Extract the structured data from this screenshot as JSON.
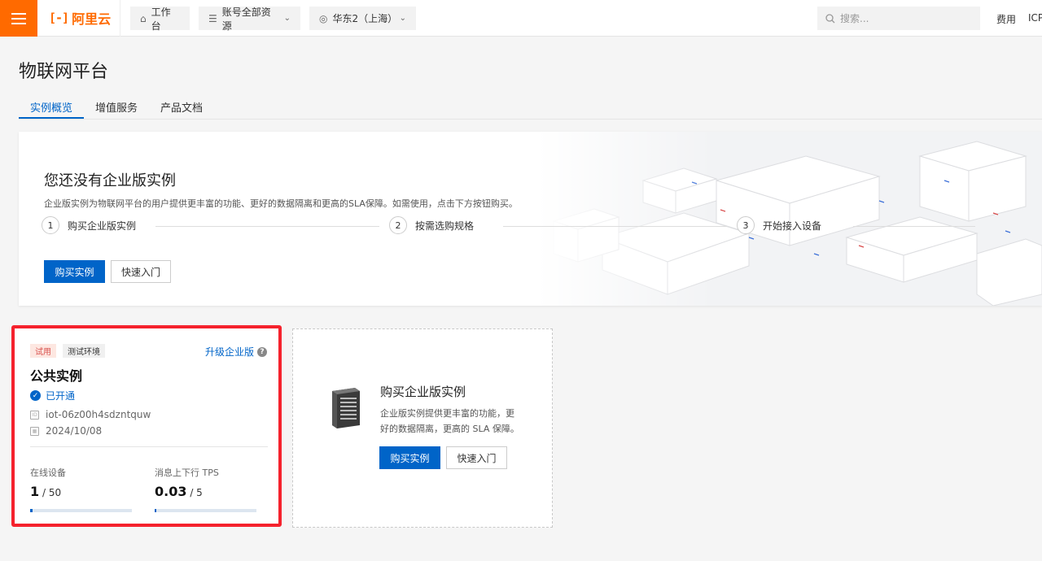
{
  "topbar": {
    "logo_mark": "[-]",
    "logo_text": "阿里云",
    "workbench": "工作台",
    "resources": "账号全部资源",
    "region": "华东2（上海）",
    "search_placeholder": "搜索...",
    "fee": "费用",
    "icp": "ICP"
  },
  "page": {
    "title": "物联网平台",
    "tabs": [
      "实例概览",
      "增值服务",
      "产品文档"
    ]
  },
  "hero": {
    "title": "您还没有企业版实例",
    "description": "企业版实例为物联网平台的用户提供更丰富的功能、更好的数据隔离和更高的SLA保障。如需使用，点击下方按钮购买。",
    "steps": [
      {
        "num": "1",
        "label": "购买企业版实例"
      },
      {
        "num": "2",
        "label": "按需选购规格"
      },
      {
        "num": "3",
        "label": "开始接入设备"
      }
    ],
    "buy_label": "购买实例",
    "start_label": "快速入门"
  },
  "instance": {
    "tag_trial": "试用",
    "tag_env": "测试环境",
    "upgrade": "升级企业版",
    "help": "?",
    "name": "公共实例",
    "status": "已开通",
    "id": "iot-06z00h4sdzntquw",
    "date": "2024/10/08",
    "online_label": "在线设备",
    "online_value": "1",
    "online_total": "/ 50",
    "online_ratio": 0.02,
    "tps_label": "消息上下行 TPS",
    "tps_value": "0.03",
    "tps_total": "/ 5",
    "tps_ratio": 0.006
  },
  "buy_card": {
    "title": "购买企业版实例",
    "description": "企业版实例提供更丰富的功能，更好的数据隔离，更高的 SLA 保障。",
    "buy_label": "购买实例",
    "start_label": "快速入门"
  },
  "colors": {
    "brand": "#ff6a00",
    "primary": "#0064c8",
    "highlight": "#f5222d"
  }
}
